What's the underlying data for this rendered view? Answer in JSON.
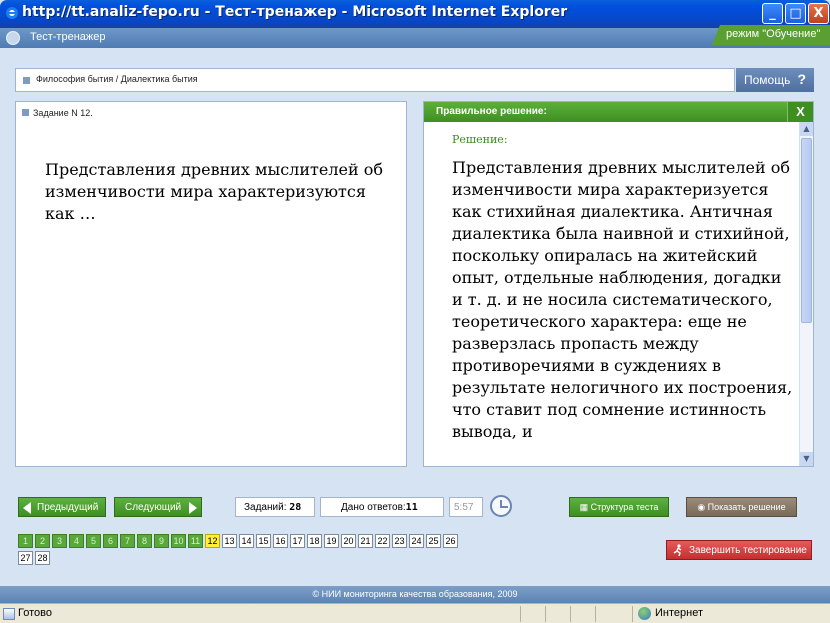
{
  "window": {
    "title": "http://tt.analiz-fepo.ru - Тест-тренажер - Microsoft Internet Explorer",
    "minimize": "_",
    "maximize": "□",
    "close": "X"
  },
  "app": {
    "title": "Тест-тренажер",
    "mode": "режим \"Обучение\""
  },
  "breadcrumb": "Философия бытия / Диалектика бытия",
  "help": {
    "label": "Помощь",
    "icon": "?"
  },
  "task": {
    "header": "Задание N 12.",
    "question": "Представления древних мыслителей об изменчивости мира характеризуются как …"
  },
  "solution": {
    "panel_title": "Правильное решение:",
    "close": "X",
    "heading": "Решение:",
    "text": "Представления древних мыслителей об изменчивости мира характеризуется как стихийная диалектика. Античная диалектика была наивной и стихийной, поскольку опиралась на житейский опыт, отдельные наблюдения, догадки и т. д. и не носила систематического, теоретического характера: еще не разверзлась пропасть между противоречиями в суждениях в результате нелогичного их построения, что ставит под сомнение истинность вывода, и"
  },
  "nav": {
    "prev": "Предыдущий",
    "next": "Следующий",
    "tasks_label": "Заданий:",
    "tasks_value": "28",
    "answered_label": "Дано ответов:",
    "answered_value": "11",
    "timer": "5:57",
    "structure": "Структура теста",
    "show_solution": "Показать решение",
    "finish": "Завершить тестирование"
  },
  "pager": {
    "pages": [
      "1",
      "2",
      "3",
      "4",
      "5",
      "6",
      "7",
      "8",
      "9",
      "10",
      "11",
      "12",
      "13",
      "14",
      "15",
      "16",
      "17",
      "18",
      "19",
      "20",
      "21",
      "22",
      "23",
      "24",
      "25",
      "26",
      "27",
      "28"
    ],
    "answered": 11,
    "current": "12"
  },
  "footer": "© НИИ мониторинга качества образования, 2009",
  "statusbar": {
    "ready": "Готово",
    "zone": "Интернет"
  },
  "colors": {
    "accent_green": "#3d8f22",
    "current_page": "#ffef3a",
    "finish_red": "#c42f2f"
  }
}
